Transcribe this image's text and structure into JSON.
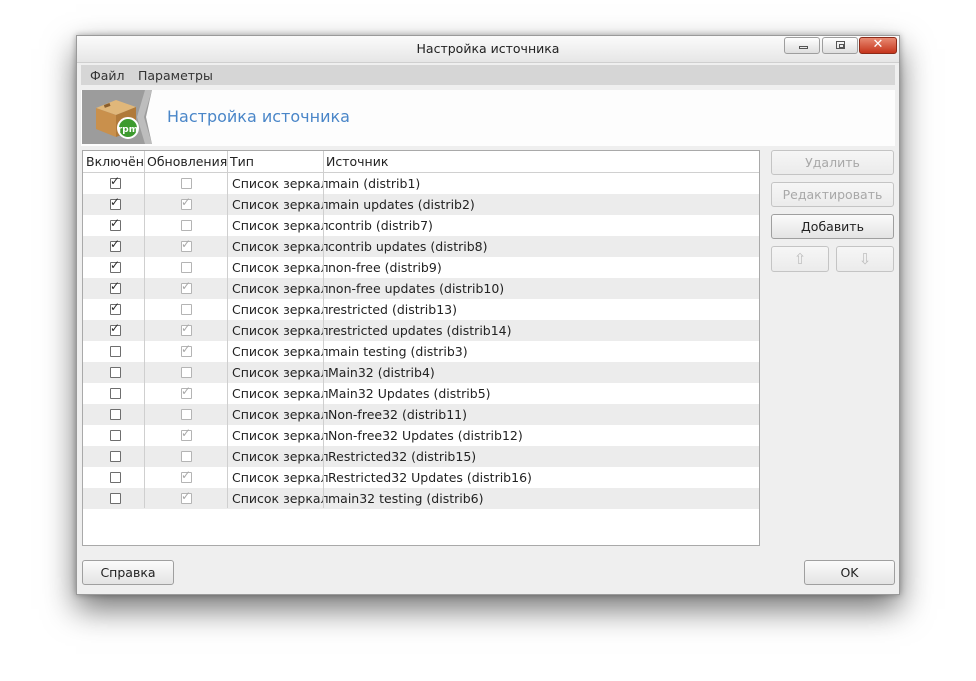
{
  "window": {
    "title": "Настройка источника"
  },
  "menubar": {
    "file": "Файл",
    "params": "Параметры"
  },
  "banner": {
    "title": "Настройка источника",
    "logo_text": "rpm"
  },
  "table": {
    "headers": {
      "enabled": "Включён",
      "updates": "Обновления",
      "type": "Тип",
      "source": "Источник"
    },
    "rows": [
      {
        "enabled": true,
        "updates": false,
        "type": "Список зеркал",
        "source": "main (distrib1)"
      },
      {
        "enabled": true,
        "updates": true,
        "type": "Список зеркал",
        "source": "main updates (distrib2)"
      },
      {
        "enabled": true,
        "updates": false,
        "type": "Список зеркал",
        "source": "contrib (distrib7)"
      },
      {
        "enabled": true,
        "updates": true,
        "type": "Список зеркал",
        "source": "contrib updates (distrib8)"
      },
      {
        "enabled": true,
        "updates": false,
        "type": "Список зеркал",
        "source": "non-free (distrib9)"
      },
      {
        "enabled": true,
        "updates": true,
        "type": "Список зеркал",
        "source": "non-free updates (distrib10)"
      },
      {
        "enabled": true,
        "updates": false,
        "type": "Список зеркал",
        "source": "restricted (distrib13)"
      },
      {
        "enabled": true,
        "updates": true,
        "type": "Список зеркал",
        "source": "restricted updates (distrib14)"
      },
      {
        "enabled": false,
        "updates": true,
        "type": "Список зеркал",
        "source": "main testing (distrib3)"
      },
      {
        "enabled": false,
        "updates": false,
        "type": "Список зеркал",
        "source": "Main32 (distrib4)"
      },
      {
        "enabled": false,
        "updates": true,
        "type": "Список зеркал",
        "source": "Main32 Updates (distrib5)"
      },
      {
        "enabled": false,
        "updates": false,
        "type": "Список зеркал",
        "source": "Non-free32 (distrib11)"
      },
      {
        "enabled": false,
        "updates": true,
        "type": "Список зеркал",
        "source": "Non-free32 Updates (distrib12)"
      },
      {
        "enabled": false,
        "updates": false,
        "type": "Список зеркал",
        "source": "Restricted32 (distrib15)"
      },
      {
        "enabled": false,
        "updates": true,
        "type": "Список зеркал",
        "source": "Restricted32 Updates (distrib16)"
      },
      {
        "enabled": false,
        "updates": true,
        "type": "Список зеркал",
        "source": "main32 testing (distrib6)"
      }
    ]
  },
  "side_buttons": {
    "delete": "Удалить",
    "edit": "Редактировать",
    "add": "Добавить"
  },
  "footer": {
    "help": "Справка",
    "ok": "OK"
  },
  "colors": {
    "banner_title": "#4a86c8",
    "close_button": "#c5341b"
  }
}
